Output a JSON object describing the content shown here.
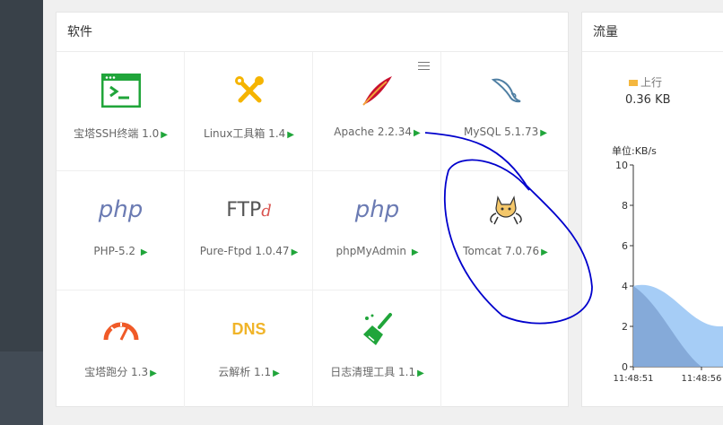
{
  "software_panel": {
    "title": "软件",
    "items": [
      {
        "label": "宝塔SSH终端 1.0",
        "icon": "terminal-icon"
      },
      {
        "label": "Linux工具箱 1.4",
        "icon": "tools-icon"
      },
      {
        "label": "Apache 2.2.34",
        "icon": "apache-feather-icon"
      },
      {
        "label": "MySQL 5.1.73",
        "icon": "mysql-dolphin-icon"
      },
      {
        "label": "PHP-5.2 ",
        "icon": "php-icon",
        "logo_text": "php"
      },
      {
        "label": "Pure-Ftpd 1.0.47",
        "icon": "ftp-icon",
        "logo_text": "FTP",
        "logo_suffix": "d"
      },
      {
        "label": "phpMyAdmin ",
        "icon": "phpmyadmin-icon",
        "logo_text": "php"
      },
      {
        "label": "Tomcat 7.0.76",
        "icon": "tomcat-icon"
      },
      {
        "label": "宝塔跑分 1.3",
        "icon": "gauge-icon"
      },
      {
        "label": "云解析 1.1",
        "icon": "dns-icon",
        "logo_text": "DNS"
      },
      {
        "label": "日志清理工具 1.1",
        "icon": "broom-icon"
      }
    ],
    "arrow_glyph": "▶",
    "menu_icon": "hamburger-menu-icon"
  },
  "flow_panel": {
    "title": "流量",
    "legend_label": "上行",
    "upload_value": "0.36 KB",
    "unit_label": "单位:KB/s",
    "chart_data": {
      "type": "area",
      "yticks": [
        "10",
        "8",
        "6",
        "4",
        "2",
        "0"
      ],
      "x": [
        "11:48:51",
        "11:48:56"
      ],
      "ylim": [
        0,
        10
      ],
      "series": [
        {
          "name": "上行",
          "values": [
            4,
            0
          ],
          "color": "#7a9ecf"
        },
        {
          "name": "",
          "values": [
            4,
            2
          ],
          "color": "#9cc8f5"
        }
      ]
    }
  },
  "colors": {
    "accent": "#20a53a",
    "sidebar": "#394149",
    "annotation": "#0000cc"
  }
}
